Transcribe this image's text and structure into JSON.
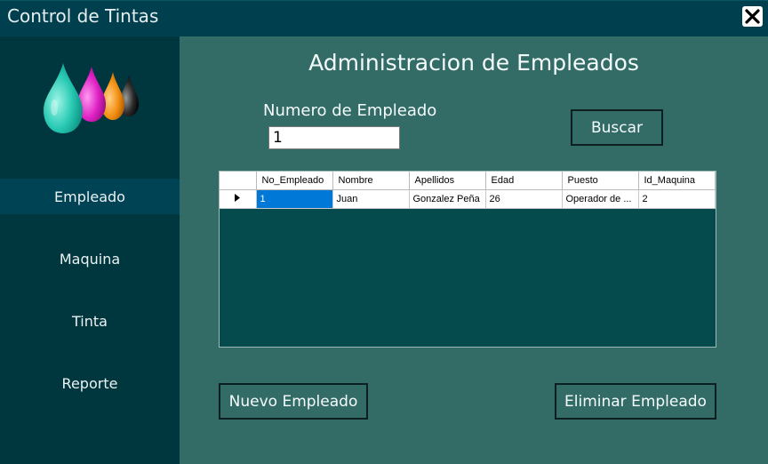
{
  "window": {
    "title": "Control de Tintas",
    "close_icon": "close-icon"
  },
  "sidebar": {
    "logo_icon": "ink-drops-logo",
    "items": [
      {
        "label": "Empleado",
        "active": true
      },
      {
        "label": "Maquina",
        "active": false
      },
      {
        "label": "Tinta",
        "active": false
      },
      {
        "label": "Reporte",
        "active": false
      }
    ]
  },
  "main": {
    "heading": "Administracion de Empleados",
    "search_label": "Numero de Empleado",
    "search_value": "1",
    "search_button": "Buscar",
    "new_button": "Nuevo Empleado",
    "delete_button": "Eliminar Empleado"
  },
  "grid": {
    "columns": [
      "No_Empleado",
      "Nombre",
      "Apellidos",
      "Edad",
      "Puesto",
      "Id_Maquina"
    ],
    "rows": [
      [
        "1",
        "Juan",
        "Gonzalez Peña",
        "26",
        "Operador de ...",
        "2"
      ]
    ],
    "current_row_icon": "row-pointer-icon"
  },
  "colors": {
    "titlebar": "#003f4d",
    "sidebar": "#00363d",
    "sidebar_active": "#004354",
    "main": "#336b66",
    "grid_empty": "#054b4d",
    "selection": "#0078d7"
  }
}
